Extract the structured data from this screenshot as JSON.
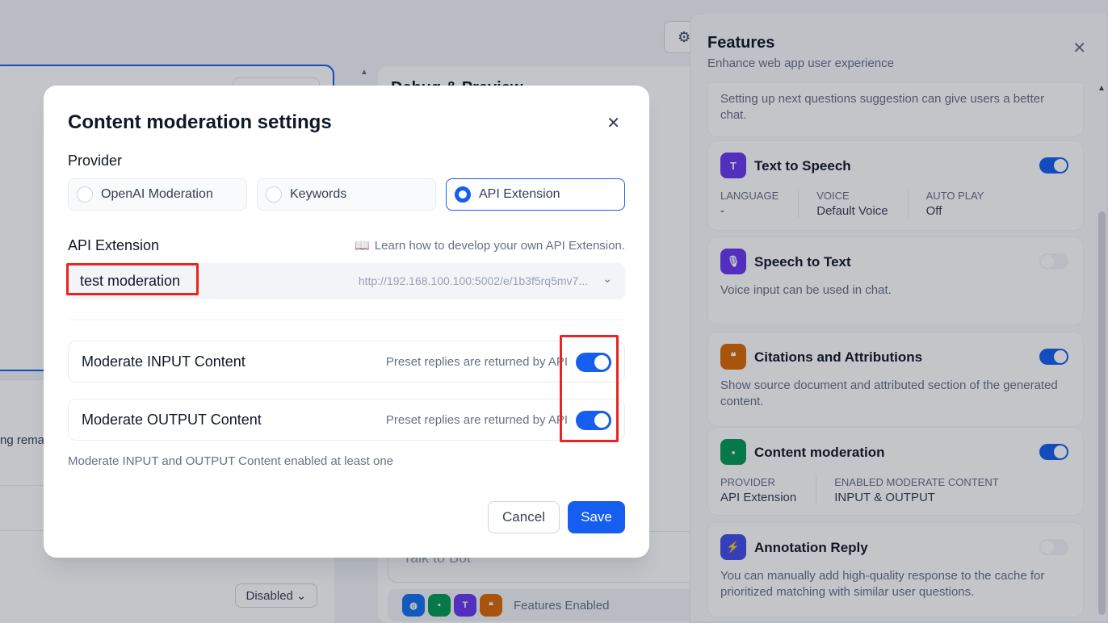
{
  "background": {
    "left_partial_text": "ng rema",
    "disabled_select": "Disabled",
    "middle_title": "Debug & Preview",
    "chat_placeholder": "Talk to Bot",
    "features_enabled": "Features Enabled"
  },
  "features_panel": {
    "title": "Features",
    "subtitle": "Enhance web app user experience",
    "close_icon": "close-icon",
    "top_partial_desc": "Setting up next questions suggestion can give users a better chat.",
    "cards": [
      {
        "title": "Text to Speech",
        "icon": "text-to-speech-icon",
        "enabled": true,
        "meta": [
          {
            "key": "LANGUAGE",
            "value": "-"
          },
          {
            "key": "VOICE",
            "value": "Default Voice"
          },
          {
            "key": "AUTO PLAY",
            "value": "Off"
          }
        ]
      },
      {
        "title": "Speech to Text",
        "icon": "microphone-icon",
        "enabled": false,
        "desc": "Voice input can be used in chat."
      },
      {
        "title": "Citations and Attributions",
        "icon": "quote-icon",
        "enabled": true,
        "desc": "Show source document and attributed section of the generated content."
      },
      {
        "title": "Content moderation",
        "icon": "shield-icon",
        "enabled": true,
        "meta": [
          {
            "key": "PROVIDER",
            "value": "API Extension"
          },
          {
            "key": "ENABLED MODERATE CONTENT",
            "value": "INPUT & OUTPUT"
          }
        ]
      },
      {
        "title": "Annotation Reply",
        "icon": "annotation-icon",
        "enabled": false,
        "desc": "You can manually add high-quality response to the cache for prioritized matching with similar user questions."
      }
    ]
  },
  "modal": {
    "title": "Content moderation settings",
    "provider_label": "Provider",
    "providers": [
      {
        "label": "OpenAI Moderation",
        "selected": false
      },
      {
        "label": "Keywords",
        "selected": false
      },
      {
        "label": "API Extension",
        "selected": true
      }
    ],
    "api_extension_label": "API Extension",
    "learn_link": "Learn how to develop your own API Extension.",
    "api_select": {
      "name": "test moderation",
      "url": "http://192.168.100.100:5002/e/1b3f5rq5mv7..."
    },
    "moderate_input": {
      "label": "Moderate INPUT Content",
      "hint": "Preset replies are returned by API",
      "enabled": true
    },
    "moderate_output": {
      "label": "Moderate OUTPUT Content",
      "hint": "Preset replies are returned by API",
      "enabled": true
    },
    "note": "Moderate INPUT and OUTPUT Content enabled at least one",
    "cancel_label": "Cancel",
    "save_label": "Save"
  },
  "colors": {
    "accent": "#155eef",
    "highlight": "#e8251f"
  }
}
